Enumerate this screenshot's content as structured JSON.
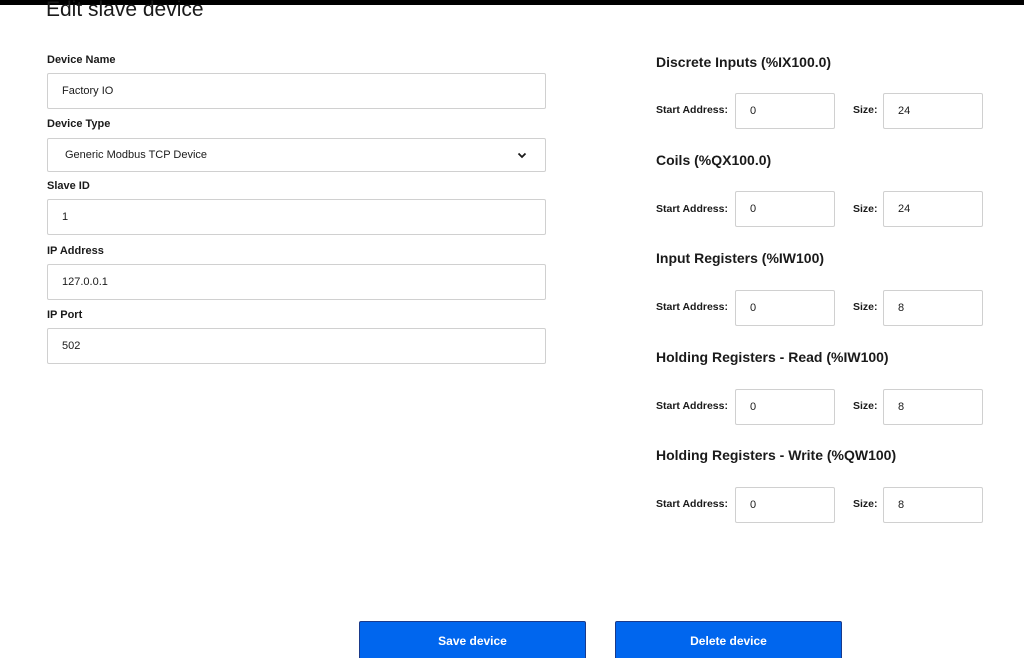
{
  "page": {
    "title": "Edit slave device"
  },
  "device": {
    "name_label": "Device Name",
    "name_value": "Factory IO",
    "type_label": "Device Type",
    "type_value": "Generic Modbus TCP Device",
    "slave_id_label": "Slave ID",
    "slave_id_value": "1",
    "ip_label": "IP Address",
    "ip_value": "127.0.0.1",
    "port_label": "IP Port",
    "port_value": "502"
  },
  "sections": [
    {
      "title": "Discrete Inputs (%IX100.0)",
      "start_label": "Start Address:",
      "start": "0",
      "size_label": "Size:",
      "size": "24"
    },
    {
      "title": "Coils (%QX100.0)",
      "start_label": "Start Address:",
      "start": "0",
      "size_label": "Size:",
      "size": "24"
    },
    {
      "title": "Input Registers (%IW100)",
      "start_label": "Start Address:",
      "start": "0",
      "size_label": "Size:",
      "size": "8"
    },
    {
      "title": "Holding Registers - Read (%IW100)",
      "start_label": "Start Address:",
      "start": "0",
      "size_label": "Size:",
      "size": "8"
    },
    {
      "title": "Holding Registers - Write (%QW100)",
      "start_label": "Start Address:",
      "start": "0",
      "size_label": "Size:",
      "size": "8"
    }
  ],
  "actions": {
    "save_label": "Save device",
    "delete_label": "Delete device"
  },
  "colors": {
    "button_bg": "#0066ee",
    "button_text": "#ffffff",
    "input_border": "#d0d0d0"
  }
}
